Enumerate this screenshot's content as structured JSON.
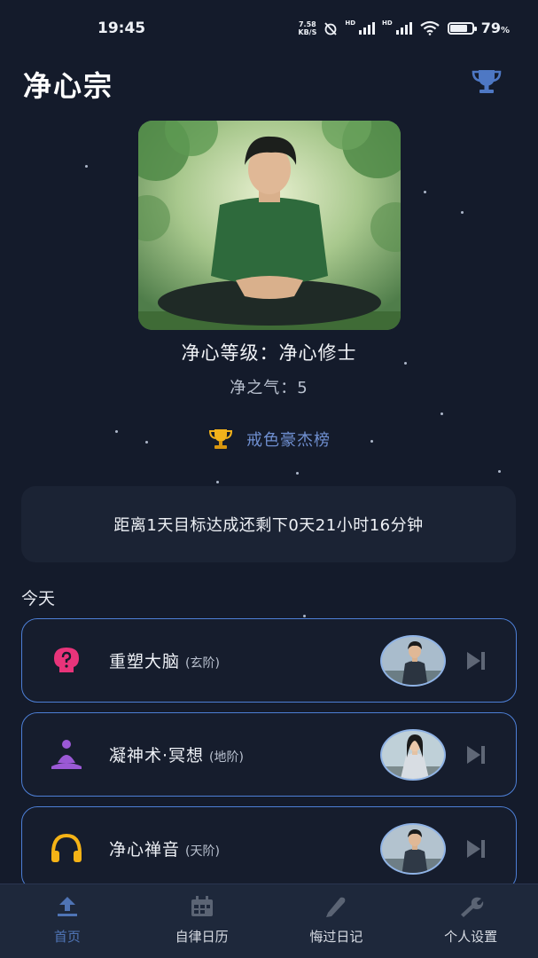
{
  "status_bar": {
    "time": "19:45",
    "net_speed_value": "7.58",
    "net_speed_unit": "KB/S",
    "hd_1": "HD",
    "hd_2": "HD",
    "battery_percent_value": "79",
    "battery_percent_sign": "%",
    "battery_level": 0.79
  },
  "header": {
    "title": "净心宗",
    "trophy_icon": "trophy-icon"
  },
  "profile": {
    "level_text": "净心等级：净心修士",
    "qi_text": "净之气：5",
    "ranking_label": "戒色豪杰榜"
  },
  "countdown": {
    "text": "距离1天目标达成还剩下0天21小时16分钟"
  },
  "today": {
    "title": "今天",
    "tasks": [
      {
        "name": "重塑大脑",
        "tier": "(玄阶)",
        "icon": "brain-icon",
        "color": "#e8347a"
      },
      {
        "name": "凝神术·冥想",
        "tier": "(地阶)",
        "icon": "meditation-icon",
        "color": "#9b59d6"
      },
      {
        "name": "净心禅音",
        "tier": "(天阶)",
        "icon": "headphones-icon",
        "color": "#f5b316"
      }
    ]
  },
  "bottom_nav": {
    "items": [
      {
        "label": "首页",
        "icon": "home-upload-icon",
        "active": true
      },
      {
        "label": "自律日历",
        "icon": "calendar-icon",
        "active": false
      },
      {
        "label": "悔过日记",
        "icon": "pencil-icon",
        "active": false
      },
      {
        "label": "个人设置",
        "icon": "wrench-icon",
        "active": false
      }
    ]
  },
  "colors": {
    "background": "#141b2b",
    "accent_blue": "#4d7fd6",
    "active_nav": "#4f74b5"
  }
}
